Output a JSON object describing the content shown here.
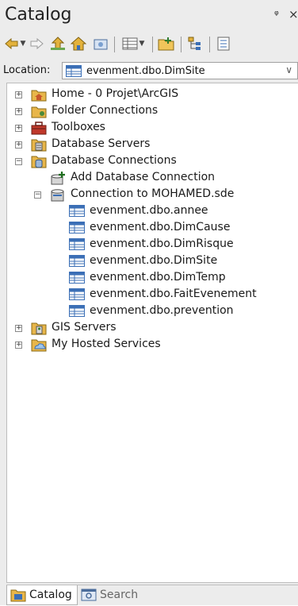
{
  "window": {
    "title": "Catalog",
    "pin_glyph": "ᵠ",
    "close_glyph": "×"
  },
  "toolbar": {
    "icons": [
      "back-arrow-icon",
      "forward-arrow-icon",
      "up-one-level-icon",
      "home-icon",
      "toggle-contents-icon",
      "view-options-icon",
      "connect-folder-icon",
      "tree-icon",
      "properties-icon"
    ]
  },
  "location": {
    "label": "Location:",
    "value": "evenment.dbo.DimSite"
  },
  "tree": {
    "nodes": [
      {
        "label": "Home - 0 Projet\\ArcGIS",
        "expander": "+",
        "icon": "home-folder-icon"
      },
      {
        "label": "Folder Connections",
        "expander": "+",
        "icon": "folder-icon"
      },
      {
        "label": "Toolboxes",
        "expander": "+",
        "icon": "toolbox-icon"
      },
      {
        "label": "Database Servers",
        "expander": "+",
        "icon": "database-server-icon"
      },
      {
        "label": "Database Connections",
        "expander": "−",
        "icon": "database-connections-icon"
      },
      {
        "label": "Add Database Connection",
        "icon": "add-connection-icon"
      },
      {
        "label": "Connection to MOHAMED.sde",
        "expander": "−",
        "icon": "sde-connection-icon"
      },
      {
        "label": "evenment.dbo.annee",
        "icon": "table-icon"
      },
      {
        "label": "evenment.dbo.DimCause",
        "icon": "table-icon"
      },
      {
        "label": "evenment.dbo.DimRisque",
        "icon": "table-icon"
      },
      {
        "label": "evenment.dbo.DimSite",
        "icon": "table-icon"
      },
      {
        "label": "evenment.dbo.DimTemp",
        "icon": "table-icon"
      },
      {
        "label": "evenment.dbo.FaitEvenement",
        "icon": "table-icon"
      },
      {
        "label": "evenment.dbo.prevention",
        "icon": "table-icon"
      },
      {
        "label": "GIS Servers",
        "expander": "+",
        "icon": "gis-server-icon"
      },
      {
        "label": "My Hosted Services",
        "expander": "+",
        "icon": "hosted-services-icon"
      }
    ]
  },
  "tabs": [
    {
      "label": "Catalog",
      "active": true
    },
    {
      "label": "Search",
      "active": false
    }
  ],
  "colors": {
    "folder": "#e8b64a",
    "table_blue": "#3b6fb6",
    "panel_bg": "#ececec"
  }
}
